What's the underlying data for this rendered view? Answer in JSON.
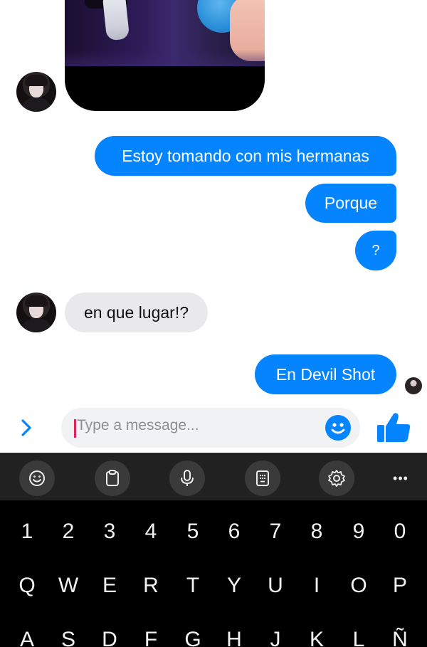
{
  "messages": {
    "outgoing": [
      "Estoy tomando con mis hermanas",
      "Porque",
      "?",
      "En Devil Shot"
    ],
    "incoming": [
      "en que lugar!?"
    ]
  },
  "composer": {
    "placeholder": "Type a message..."
  },
  "keyboard": {
    "toolbar_icons": [
      "emoji-icon",
      "clipboard-icon",
      "microphone-icon",
      "keypad-icon",
      "settings-icon",
      "more-icon"
    ],
    "more_label": "•••",
    "row_numbers": [
      "1",
      "2",
      "3",
      "4",
      "5",
      "6",
      "7",
      "8",
      "9",
      "0"
    ],
    "row_qwerty": [
      "Q",
      "W",
      "E",
      "R",
      "T",
      "Y",
      "U",
      "I",
      "O",
      "P"
    ],
    "row_asdf": [
      "A",
      "S",
      "D",
      "F",
      "G",
      "H",
      "J",
      "K",
      "L",
      "Ñ"
    ]
  },
  "colors": {
    "accent": "#0584ff",
    "incoming_bubble": "#e9e9eb",
    "keyboard_bg": "#000000",
    "toolbar_bg": "#212121"
  }
}
